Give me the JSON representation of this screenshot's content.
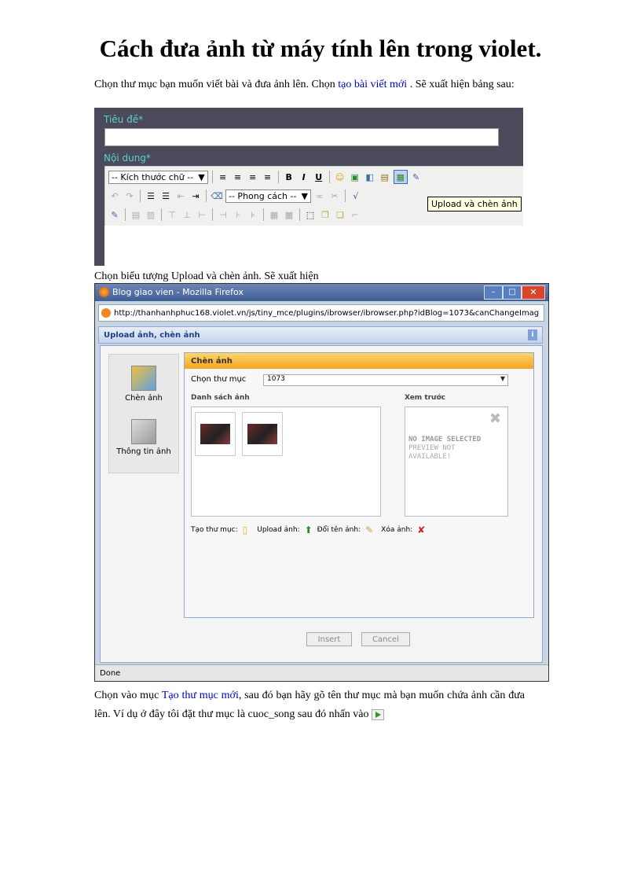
{
  "doc": {
    "title": "Cách đưa ảnh từ máy tính lên trong violet.",
    "p1_before": "Chọn thư mục bạn muốn viết bài và đưa ảnh lên. Chọn ",
    "p1_link": "tạo bài viết mới",
    "p1_after": " . Sẽ xuất hiện bảng sau:",
    "p2": "Chọn biểu tượng Upload và chèn ảnh. Sẽ xuất hiện",
    "p3_before": "Chọn vào mục ",
    "p3_link": "Tạo thư mục mới",
    "p3_after": ", sau đó bạn hãy gõ tên thư mục mà bạn muốn chứa ảnh cần đưa lên. Ví dụ ở đây tôi đặt thư mục là cuoc_song sau đó nhấn vào"
  },
  "editor": {
    "title_label": "Tiêu đề*",
    "content_label": "Nội dung*",
    "font_size_select": "-- Kích thước chữ --",
    "style_select": "-- Phong cách --",
    "tooltip": "Upload và chèn ảnh"
  },
  "firefox": {
    "window_title": "Blog giao vien - Mozilla Firefox",
    "url": "http://thanhanhphuc168.violet.vn/js/tiny_mce/plugins/ibrowser/ibrowser.php?idBlog=1073&canChangeImag",
    "dialog_title": "Upload ảnh, chèn ảnh",
    "sidebar": {
      "insert_label": "Chèn ảnh",
      "info_label": "Thông tin ảnh"
    },
    "panel_title": "Chèn ảnh",
    "folder_label": "Chọn thư mục",
    "folder_value": "1073",
    "list_label": "Danh sách ảnh",
    "preview_label": "Xem trước",
    "no_image_line1": "NO IMAGE SELECTED",
    "no_image_line2": "PREVIEW NOT",
    "no_image_line3": "AVAILABLE!",
    "actions": {
      "create_folder": "Tạo thư mục:",
      "upload": "Upload ảnh:",
      "rename": "Đổi tên ảnh:",
      "delete": "Xóa ảnh:"
    },
    "insert_button": "Insert",
    "cancel_button": "Cancel",
    "status": "Done"
  }
}
